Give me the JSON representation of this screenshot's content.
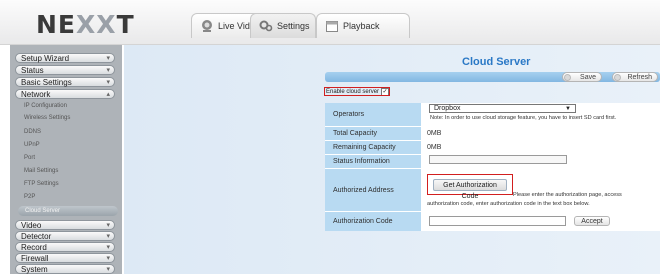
{
  "header": {
    "logo_main": "NE",
    "logo_mid": "XX",
    "logo_end": "T",
    "tabs": [
      {
        "label": "Live Video",
        "icon": "camera-icon"
      },
      {
        "label": "Settings",
        "icon": "gears-icon"
      },
      {
        "label": "Playback",
        "icon": "calendar-icon"
      }
    ]
  },
  "sidebar": {
    "items": [
      {
        "label": "Setup Wizard"
      },
      {
        "label": "Status"
      },
      {
        "label": "Basic Settings"
      },
      {
        "label": "Network"
      }
    ],
    "network_subitems": [
      "IP Configuration",
      "Wireless Settings",
      "DDNS",
      "UPnP",
      "Port",
      "Mail Settings",
      "FTP Settings",
      "P2P"
    ],
    "active_subitem": "Cloud Server",
    "items_after": [
      {
        "label": "Video"
      },
      {
        "label": "Detector"
      },
      {
        "label": "Record"
      },
      {
        "label": "Firewall"
      },
      {
        "label": "System"
      }
    ]
  },
  "main": {
    "title": "Cloud Server",
    "save_label": "Save",
    "refresh_label": "Refresh",
    "enable_label": "Enable cloud server",
    "enable_checked_mark": "✓",
    "operators_label": "Operators",
    "operators_value": "Dropbox",
    "operators_note": "Note: In order to use cloud storage feature, you have to insert SD card first.",
    "total_capacity_label": "Total Capacity",
    "total_capacity_value": "0MB",
    "remaining_capacity_label": "Remaining Capacity",
    "remaining_capacity_value": "0MB",
    "status_info_label": "Status Information",
    "authorized_address_label": "Authorized Address",
    "get_auth_code_label": "Get Authorization Code",
    "auth_instructions_1": "Please enter the authorization page, access",
    "auth_instructions_2": "authorization code, enter authorization code in the text box below.",
    "auth_code_label": "Authorization Code",
    "accept_label": "Accept"
  },
  "colors": {
    "title_blue": "#2a78c6",
    "label_bg": "#b8daf2",
    "highlight_red": "#d21f1f"
  }
}
